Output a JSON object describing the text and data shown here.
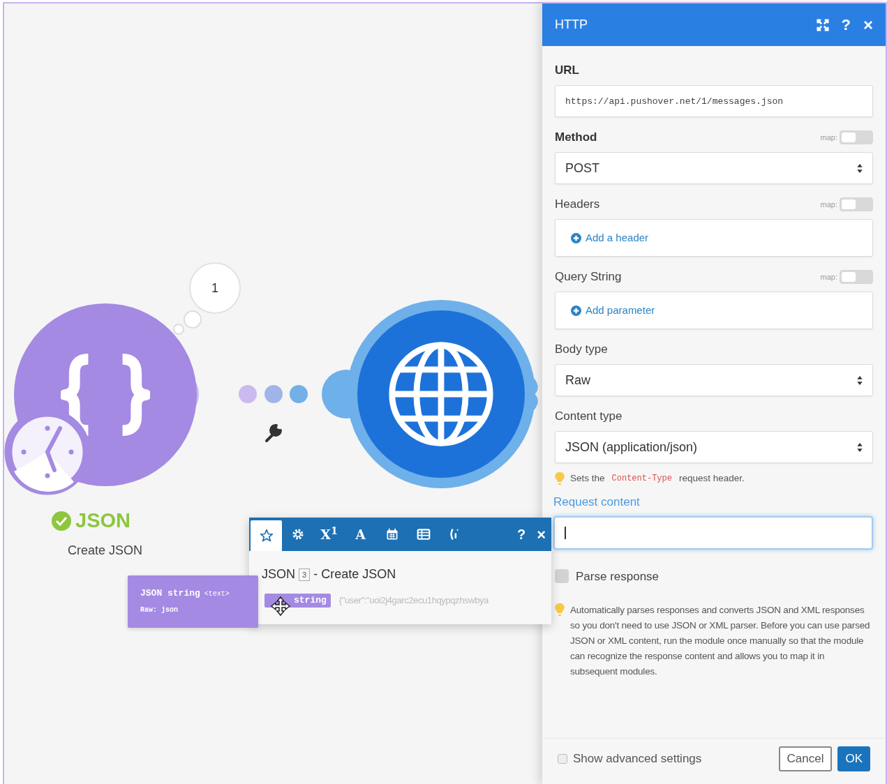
{
  "canvas": {
    "bubble": "1",
    "modules": [
      {
        "kind": "json",
        "title": "JSON",
        "subtitle": "Create JSON",
        "done": true
      },
      {
        "kind": "http"
      }
    ]
  },
  "mapping_popup": {
    "tabs": [
      {
        "selected": true
      },
      {
        "selected": false
      },
      {
        "label": "X$^{1}$",
        "selected": false
      },
      {
        "label": "A",
        "selected": false
      },
      {
        "selected": false
      },
      {
        "selected": false
      },
      {
        "selected": false
      }
    ],
    "help": "?",
    "close": "×",
    "module": {
      "name": "JSON",
      "number": "3",
      "title": "- Create JSON"
    },
    "item": {
      "label": "string",
      "value": "{\"user\":\"uoi2j4garc2ecu1hqypqzhswbya"
    },
    "tooltip": {
      "name": "JSON string",
      "type": "<text>",
      "detail": "Raw: json"
    }
  },
  "panel": {
    "title": "HTTP",
    "help": "?",
    "close": "×",
    "fields": [
      {
        "kind": "input",
        "label": "URL",
        "bold": true,
        "value": "https://api.pushover.net/1/messages.json"
      },
      {
        "kind": "select",
        "label": "Method",
        "bold": true,
        "map": {
          "label": "map:",
          "on": false
        },
        "value": "POST"
      },
      {
        "kind": "add",
        "label": "Headers",
        "map": {
          "label": "map:",
          "on": false
        },
        "action": "Add a header"
      },
      {
        "kind": "add",
        "label": "Query String",
        "map": {
          "label": "map:",
          "on": false
        },
        "action": "Add parameter"
      },
      {
        "kind": "select",
        "label": "Body type",
        "value": "Raw"
      },
      {
        "kind": "select",
        "label": "Content type",
        "value": "JSON (application/json)",
        "hint": [
          "Sets the",
          "Content-Type",
          "request header."
        ]
      },
      {
        "kind": "textarea",
        "label": "Request content",
        "focused": true
      },
      {
        "kind": "checkbox",
        "label": "Parse response",
        "checked": false,
        "hint": [
          "Automatically parses responses and converts JSON and XML responses so you don't need to use JSON or XML parser. Before you can use parsed JSON or XML content, run the module once manually so that the module can recognize the response content and allows you to map it in subsequent modules."
        ]
      }
    ],
    "advanced": {
      "label": "Show advanced settings",
      "checked": false
    },
    "buttons": [
      {
        "kind": "secondary",
        "label": "Cancel"
      },
      {
        "kind": "primary",
        "label": "OK"
      }
    ]
  }
}
